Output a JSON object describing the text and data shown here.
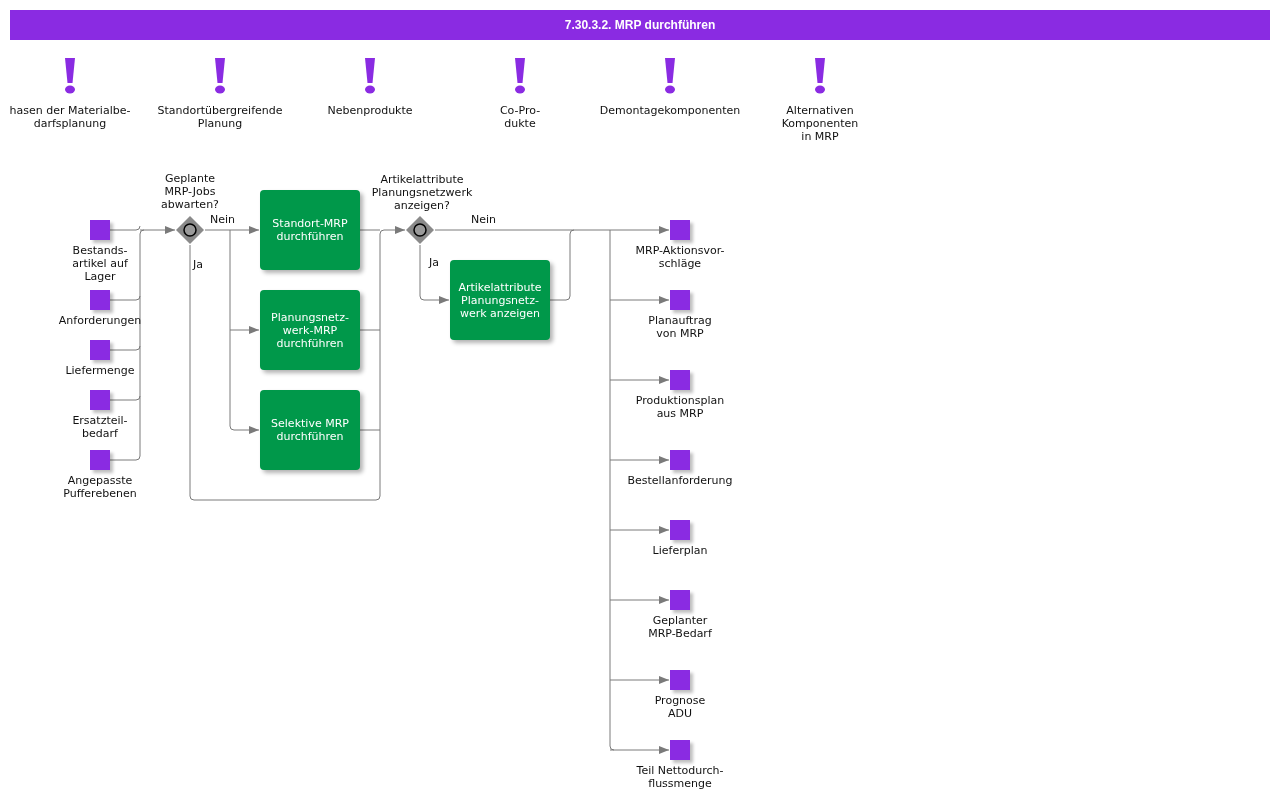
{
  "title": "7.30.3.2. MRP durchführen",
  "notes": [
    {
      "lines": [
        "hasen der Materialbe-",
        "darfsplanung"
      ]
    },
    {
      "lines": [
        "Standortübergreifende",
        "Planung"
      ]
    },
    {
      "lines": [
        "Nebenprodukte"
      ]
    },
    {
      "lines": [
        "Co-Pro-",
        "dukte"
      ]
    },
    {
      "lines": [
        "Demontagekomponenten"
      ]
    },
    {
      "lines": [
        "Alternativen",
        "Komponenten",
        "in MRP"
      ]
    }
  ],
  "inputs": [
    {
      "lines": [
        "Bestands-",
        "artikel auf",
        "Lager"
      ]
    },
    {
      "lines": [
        "Anforderungen"
      ]
    },
    {
      "lines": [
        "Liefermenge"
      ]
    },
    {
      "lines": [
        "Ersatzteil-",
        "bedarf"
      ]
    },
    {
      "lines": [
        "Angepasste",
        "Pufferebenen"
      ]
    }
  ],
  "gateways": [
    {
      "question": [
        "Geplante",
        "MRP-Jobs",
        "abwarten?"
      ],
      "no": "Nein",
      "yes": "Ja"
    },
    {
      "question": [
        "Artikelattribute",
        "Planungsnetzwerk",
        "anzeigen?"
      ],
      "no": "Nein",
      "yes": "Ja"
    }
  ],
  "tasks": [
    {
      "lines": [
        "Standort-MRP",
        "durchführen"
      ]
    },
    {
      "lines": [
        "Planungsnetz-",
        "werk-MRP",
        "durchführen"
      ]
    },
    {
      "lines": [
        "Selektive MRP",
        "durchführen"
      ]
    },
    {
      "lines": [
        "Artikelattribute",
        "Planungsnetz-",
        "werk anzeigen"
      ]
    }
  ],
  "outputs": [
    {
      "lines": [
        "MRP-Aktionsvor-",
        "schläge"
      ]
    },
    {
      "lines": [
        "Planauftrag",
        "von MRP"
      ]
    },
    {
      "lines": [
        "Produktionsplan",
        "aus MRP"
      ]
    },
    {
      "lines": [
        "Bestellanforderung"
      ]
    },
    {
      "lines": [
        "Lieferplan"
      ]
    },
    {
      "lines": [
        "Geplanter",
        "MRP-Bedarf"
      ]
    },
    {
      "lines": [
        "Prognose",
        "ADU"
      ]
    },
    {
      "lines": [
        "Teil Nettodurch-",
        "flussmenge"
      ]
    }
  ]
}
